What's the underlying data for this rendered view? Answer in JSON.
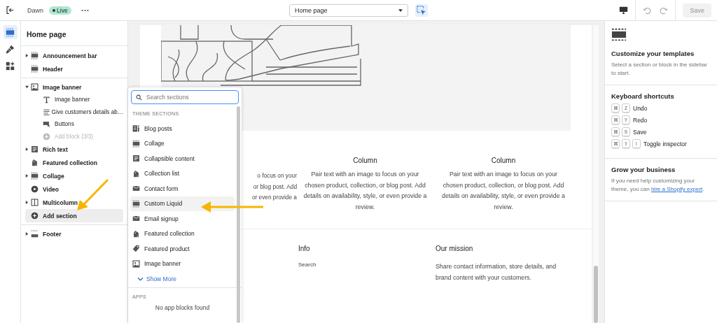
{
  "topbar": {
    "theme_name": "Dawn",
    "status_badge": "Live",
    "template_select": {
      "value": "Home page"
    },
    "inspector_toggle": {
      "selected": true
    },
    "save_button": {
      "label": "Save",
      "disabled": true
    }
  },
  "sidebar": {
    "title": "Home page",
    "items": [
      {
        "label": "Announcement bar",
        "kind": "bar",
        "expanded": false,
        "selected": false
      },
      {
        "label": "Header",
        "kind": "bar",
        "selected": false
      },
      {
        "label": "Image banner",
        "kind": "image",
        "expanded": true,
        "selected": false,
        "children": [
          {
            "label": "Image banner",
            "kind": "text",
            "disabled": false
          },
          {
            "label": "Give customers details ab…",
            "kind": "paragraph",
            "disabled": false
          },
          {
            "label": "Buttons",
            "kind": "buttons",
            "disabled": false
          },
          {
            "label": "Add block (3/3)",
            "kind": "add",
            "disabled": true
          }
        ]
      },
      {
        "label": "Rich text",
        "kind": "richtext",
        "expanded": false,
        "selected": false
      },
      {
        "label": "Featured collection",
        "kind": "collection",
        "selected": false
      },
      {
        "label": "Collage",
        "kind": "bar",
        "expanded": false,
        "selected": false
      },
      {
        "label": "Video",
        "kind": "video",
        "selected": false
      },
      {
        "label": "Multicolumn",
        "kind": "columns",
        "expanded": false,
        "selected": false
      },
      {
        "label": "Add section",
        "kind": "add",
        "selected": true
      },
      {
        "label": "Footer",
        "kind": "footer",
        "expanded": false,
        "selected": false
      }
    ]
  },
  "section_picker": {
    "search": {
      "placeholder": "Search sections"
    },
    "group_heading": "THEME SECTIONS",
    "items": [
      {
        "label": "Blog posts",
        "kind": "blog",
        "selected": false
      },
      {
        "label": "Collage",
        "kind": "bar",
        "selected": false
      },
      {
        "label": "Collapsible content",
        "kind": "richtext",
        "selected": false
      },
      {
        "label": "Collection list",
        "kind": "collection",
        "selected": false
      },
      {
        "label": "Contact form",
        "kind": "mail",
        "selected": false
      },
      {
        "label": "Custom Liquid",
        "kind": "bar",
        "selected": true
      },
      {
        "label": "Email signup",
        "kind": "mail",
        "selected": false
      },
      {
        "label": "Featured collection",
        "kind": "collection",
        "selected": false
      },
      {
        "label": "Featured product",
        "kind": "product",
        "selected": false
      },
      {
        "label": "Image banner",
        "kind": "image",
        "selected": false
      }
    ],
    "show_more": "Show More",
    "apps_heading": "APPS",
    "apps_empty": "No app blocks found"
  },
  "preview": {
    "columns": [
      {
        "lines": [
          "o focus on your",
          "or blog post. Add",
          "or even provide a"
        ]
      },
      {
        "title": "Column",
        "text": "Pair text with an image to focus on your chosen product, collection, or blog post. Add details on availability, style, or even provide a review."
      },
      {
        "title": "Column",
        "text": "Pair text with an image to focus on your chosen product, collection, or blog post. Add details on availability, style, or even provide a review."
      }
    ],
    "footer": [
      {
        "heading": "Info",
        "links": [
          "Search"
        ]
      },
      {
        "heading": "Our mission",
        "text": "Share contact information, store details, and brand content with your customers."
      }
    ]
  },
  "inspector_panel": {
    "title": "Customize your templates",
    "text": "Select a section or block in the sidebar to start.",
    "shortcuts_heading": "Keyboard shortcuts",
    "shortcuts": [
      {
        "keys": [
          "⌘",
          "Z"
        ],
        "label": "Undo"
      },
      {
        "keys": [
          "⌘",
          "Y"
        ],
        "label": "Redo"
      },
      {
        "keys": [
          "⌘",
          "S"
        ],
        "label": "Save"
      },
      {
        "keys": [
          "⌘",
          "⇧",
          "I"
        ],
        "label": "Toggle inspector"
      }
    ],
    "grow_heading": "Grow your business",
    "grow_text": "If you need help customizing your theme, you can ",
    "grow_link": "hire a Shopify expert",
    "grow_text_end": "."
  }
}
